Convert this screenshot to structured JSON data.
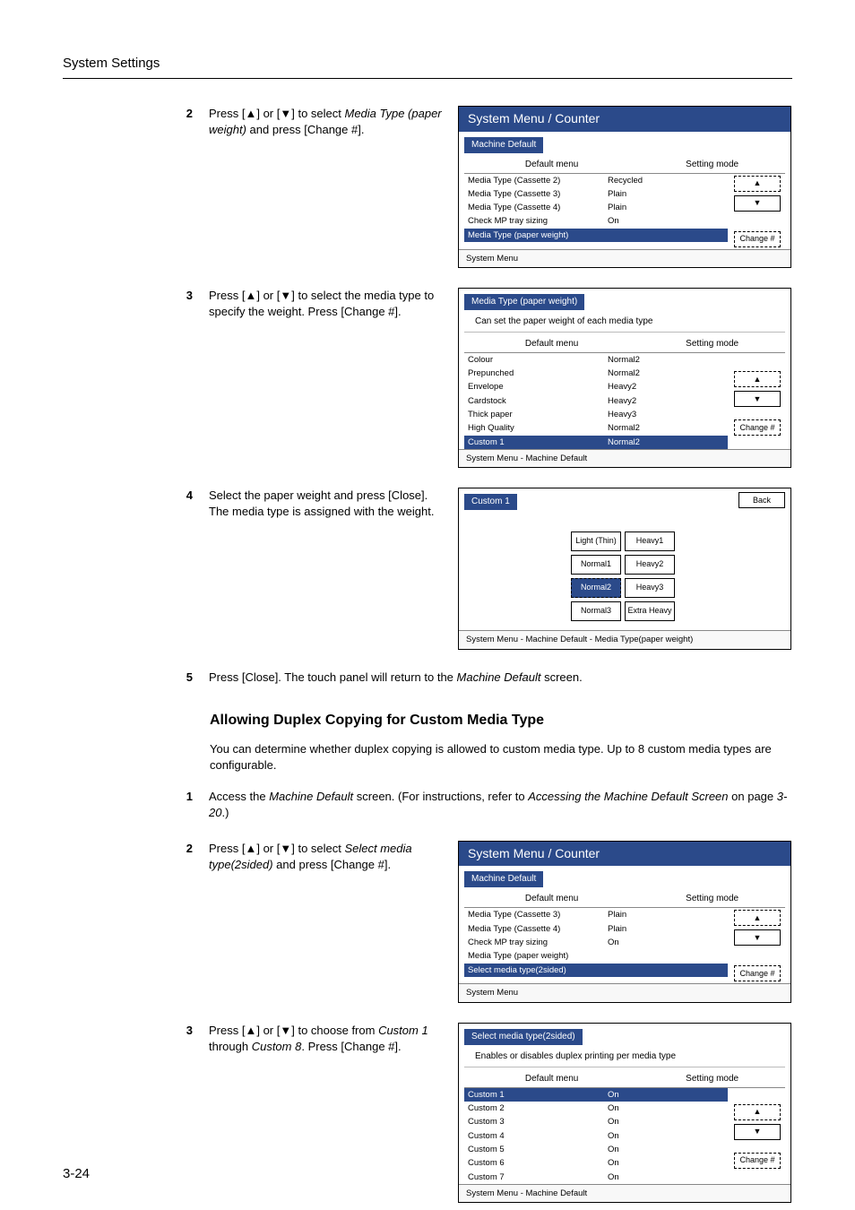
{
  "header": "System Settings",
  "page_number": "3-24",
  "trichars": {
    "up": "▲",
    "down": "▼"
  },
  "section1": {
    "step2": {
      "num": "2",
      "text_a": "Press [",
      "text_b": "] or [",
      "text_c": "] to select ",
      "italic": "Media Type (paper weight)",
      "text_d": " and press [Change #]."
    },
    "step3": {
      "num": "3",
      "text_a": "Press [",
      "text_b": "] or [",
      "text_c": "] to select the media type to specify the weight. Press [Change #]."
    },
    "step4": {
      "num": "4",
      "text": "Select the paper weight and press [Close]. The media type is assigned with the weight."
    },
    "step5": {
      "num": "5",
      "text_a": "Press [Close]. The touch panel will return to the ",
      "italic": "Machine Default",
      "text_b": " screen."
    }
  },
  "screenA": {
    "title": "System Menu / Counter",
    "tab": "Machine Default",
    "col1": "Default menu",
    "col2": "Setting mode",
    "rows": [
      {
        "l": "Media Type (Cassette 2)",
        "r": "Recycled"
      },
      {
        "l": "Media Type (Cassette 3)",
        "r": "Plain"
      },
      {
        "l": "Media Type (Cassette 4)",
        "r": "Plain"
      },
      {
        "l": "Check MP tray sizing",
        "r": "On"
      },
      {
        "l": "Media Type (paper weight)",
        "r": "",
        "selected": true
      }
    ],
    "change": "Change #",
    "breadcrumb": "System Menu"
  },
  "screenB": {
    "tab": "Media Type (paper weight)",
    "note": "Can set the paper weight of each media type",
    "col1": "Default menu",
    "col2": "Setting mode",
    "rows": [
      {
        "l": "Colour",
        "r": "Normal2"
      },
      {
        "l": "Prepunched",
        "r": "Normal2"
      },
      {
        "l": "Envelope",
        "r": "Heavy2"
      },
      {
        "l": "Cardstock",
        "r": "Heavy2"
      },
      {
        "l": "Thick paper",
        "r": "Heavy3"
      },
      {
        "l": "High Quality",
        "r": "Normal2"
      },
      {
        "l": "Custom 1",
        "r": "Normal2",
        "selected": true
      }
    ],
    "change": "Change #",
    "breadcrumb": "System Menu       -   Machine Default"
  },
  "screenC": {
    "tab": "Custom 1",
    "back": "Back",
    "weights": [
      "Light (Thin)",
      "Heavy1",
      "Normal1",
      "Heavy2",
      "Normal2",
      "Heavy3",
      "Normal3",
      "Extra Heavy"
    ],
    "selected_index": 4,
    "breadcrumb": "System Menu     -  Machine Default  -   Media Type(paper weight)"
  },
  "section2_title": "Allowing Duplex Copying for Custom Media Type",
  "section2_para": "You can determine whether duplex copying is allowed to custom media type. Up to 8 custom media types are configurable.",
  "section2": {
    "step1": {
      "num": "1",
      "text_a": "Access the ",
      "italic1": "Machine Default",
      "text_b": " screen. (For instructions, refer to ",
      "italic2": "Accessing the Machine Default Screen",
      "text_c": " on page ",
      "italic3": "3-20",
      "text_d": ".)"
    },
    "step2": {
      "num": "2",
      "text_a": "Press [",
      "text_b": "] or [",
      "text_c": "] to select ",
      "italic": "Select media type(2sided)",
      "text_d": " and press [Change #]."
    },
    "step3": {
      "num": "3",
      "text_a": "Press [",
      "text_b": "] or [",
      "text_c": "] to choose from ",
      "italic1": "Custom 1",
      "text_d": " through ",
      "italic2": "Custom 8",
      "text_e": ". Press [Change #]."
    }
  },
  "screenD": {
    "title": "System Menu / Counter",
    "tab": "Machine Default",
    "col1": "Default menu",
    "col2": "Setting mode",
    "rows": [
      {
        "l": "Media Type (Cassette 3)",
        "r": "Plain"
      },
      {
        "l": "Media Type (Cassette 4)",
        "r": "Plain"
      },
      {
        "l": "Check MP tray sizing",
        "r": "On"
      },
      {
        "l": "Media Type (paper weight)",
        "r": ""
      },
      {
        "l": "Select media type(2sided)",
        "r": "",
        "selected": true
      }
    ],
    "change": "Change #",
    "breadcrumb": "System Menu"
  },
  "screenE": {
    "tab": "Select media type(2sided)",
    "note": "Enables or disables duplex printing per media type",
    "col1": "Default menu",
    "col2": "Setting mode",
    "rows": [
      {
        "l": "Custom 1",
        "r": "On",
        "selected": true
      },
      {
        "l": "Custom 2",
        "r": "On"
      },
      {
        "l": "Custom 3",
        "r": "On"
      },
      {
        "l": "Custom 4",
        "r": "On"
      },
      {
        "l": "Custom 5",
        "r": "On"
      },
      {
        "l": "Custom 6",
        "r": "On"
      },
      {
        "l": "Custom 7",
        "r": "On"
      }
    ],
    "change": "Change #",
    "breadcrumb": "System Menu         -   Machine Default"
  }
}
